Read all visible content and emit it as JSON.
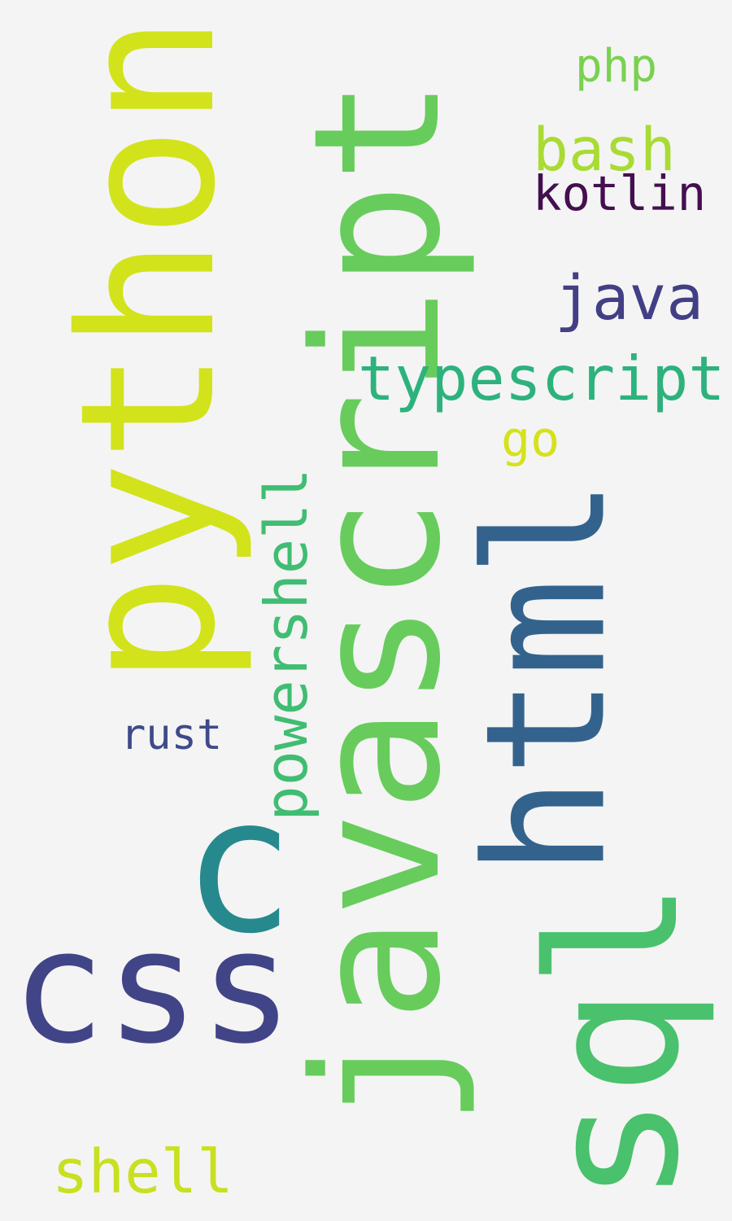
{
  "words": [
    {
      "text": "javascript",
      "color": "#67cc5c",
      "orientation": "vertical"
    },
    {
      "text": "python",
      "color": "#d2e31b",
      "orientation": "vertical"
    },
    {
      "text": "html",
      "color": "#33638d",
      "orientation": "vertical"
    },
    {
      "text": "sql",
      "color": "#4ac16d",
      "orientation": "vertical"
    },
    {
      "text": "css",
      "color": "#414487",
      "orientation": "horizontal"
    },
    {
      "text": "c",
      "color": "#26898e",
      "orientation": "horizontal"
    },
    {
      "text": "powershell",
      "color": "#40bd72",
      "orientation": "vertical"
    },
    {
      "text": "typescript",
      "color": "#2db27d",
      "orientation": "horizontal"
    },
    {
      "text": "java",
      "color": "#423f85",
      "orientation": "horizontal"
    },
    {
      "text": "bash",
      "color": "#a8db34",
      "orientation": "horizontal"
    },
    {
      "text": "kotlin",
      "color": "#440f4f",
      "orientation": "horizontal"
    },
    {
      "text": "php",
      "color": "#7ad151",
      "orientation": "horizontal"
    },
    {
      "text": "go",
      "color": "#d5e21a",
      "orientation": "horizontal"
    },
    {
      "text": "rust",
      "color": "#3e4a89",
      "orientation": "horizontal"
    },
    {
      "text": "shell",
      "color": "#c8e020",
      "orientation": "horizontal"
    }
  ]
}
